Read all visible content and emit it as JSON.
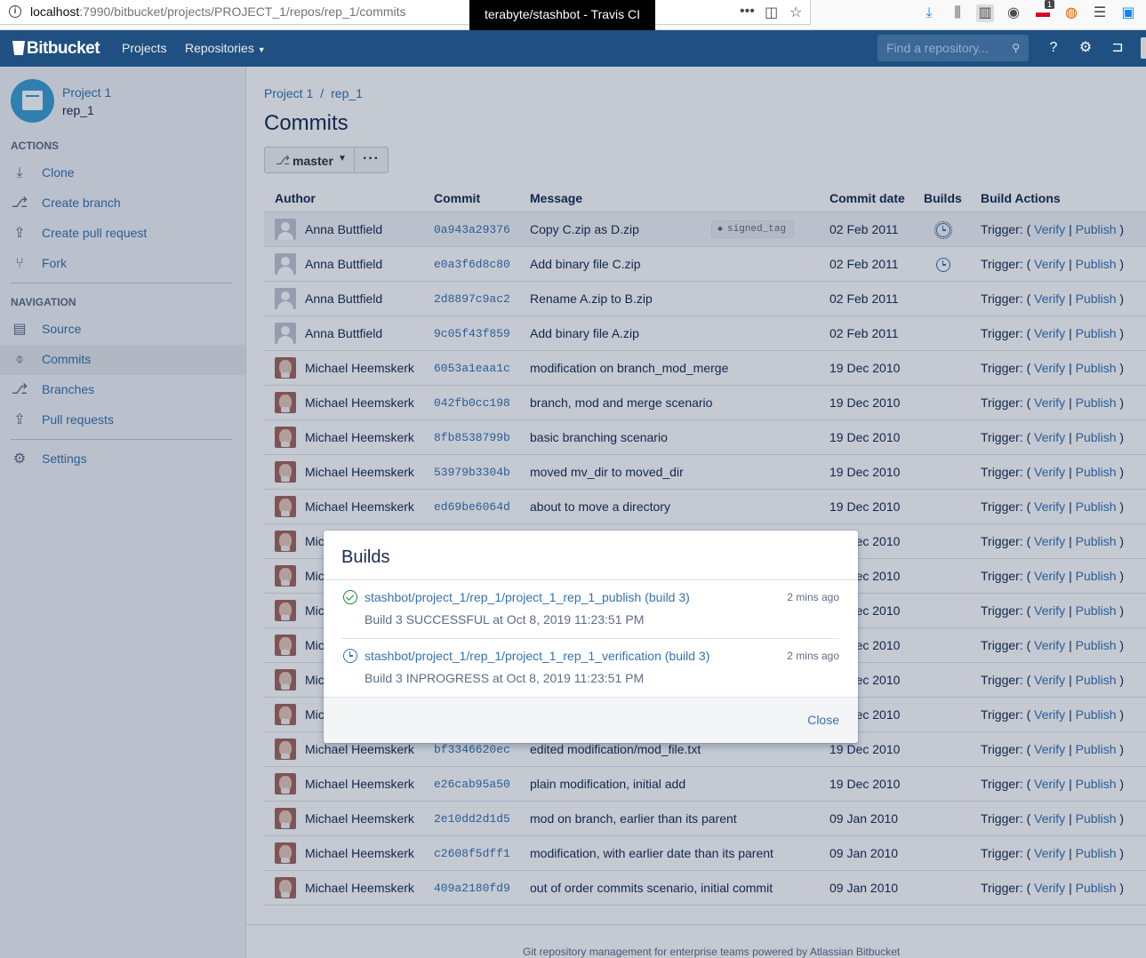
{
  "browser": {
    "url_host": "localhost",
    "url_path": ":7990/bitbucket/projects/PROJECT_1/repos/rep_1/commits",
    "tooltip": "terabyte/stashbot - Travis CI",
    "notification_badge": "1"
  },
  "header": {
    "logo": "Bitbucket",
    "nav_projects": "Projects",
    "nav_repositories": "Repositories",
    "search_placeholder": "Find a repository..."
  },
  "sidebar": {
    "project": "Project 1",
    "repo": "rep_1",
    "actions_title": "ACTIONS",
    "actions": [
      "Clone",
      "Create branch",
      "Create pull request",
      "Fork"
    ],
    "navigation_title": "NAVIGATION",
    "navigation": [
      "Source",
      "Commits",
      "Branches",
      "Pull requests"
    ],
    "settings": "Settings"
  },
  "breadcrumb": {
    "project": "Project 1",
    "separator": "/",
    "repo": "rep_1"
  },
  "page_title": "Commits",
  "branch": "master",
  "table": {
    "headers": [
      "Author",
      "Commit",
      "Message",
      "Commit date",
      "Builds",
      "Build Actions"
    ],
    "trigger_prefix": "Trigger: (",
    "verify": "Verify",
    "pipe": "|",
    "publish": "Publish",
    "trigger_suffix": ")",
    "rows": [
      {
        "author": "Anna Buttfield",
        "hash": "0a943a29376",
        "message": "Copy C.zip as D.zip",
        "tag": "signed_tag",
        "date": "02 Feb 2011",
        "build": true,
        "selected": true,
        "avatar": "gray"
      },
      {
        "author": "Anna Buttfield",
        "hash": "e0a3f6d8c80",
        "message": "Add binary file C.zip",
        "tag": "",
        "date": "02 Feb 2011",
        "build": true,
        "avatar": "gray"
      },
      {
        "author": "Anna Buttfield",
        "hash": "2d8897c9ac2",
        "message": "Rename A.zip to B.zip",
        "tag": "",
        "date": "02 Feb 2011",
        "build": false,
        "avatar": "gray"
      },
      {
        "author": "Anna Buttfield",
        "hash": "9c05f43f859",
        "message": "Add binary file A.zip",
        "tag": "",
        "date": "02 Feb 2011",
        "build": false,
        "avatar": "gray"
      },
      {
        "author": "Michael Heemskerk",
        "hash": "6053a1eaa1c",
        "message": "modification on branch_mod_merge",
        "tag": "",
        "date": "19 Dec 2010",
        "build": false,
        "avatar": "photo"
      },
      {
        "author": "Michael Heemskerk",
        "hash": "042fb0cc198",
        "message": "branch, mod and merge scenario",
        "tag": "",
        "date": "19 Dec 2010",
        "build": false,
        "avatar": "photo"
      },
      {
        "author": "Michael Heemskerk",
        "hash": "8fb8538799b",
        "message": "basic branching scenario",
        "tag": "",
        "date": "19 Dec 2010",
        "build": false,
        "avatar": "photo"
      },
      {
        "author": "Michael Heemskerk",
        "hash": "53979b3304b",
        "message": "moved mv_dir to moved_dir",
        "tag": "",
        "date": "19 Dec 2010",
        "build": false,
        "avatar": "photo"
      },
      {
        "author": "Michael Heemskerk",
        "hash": "ed69be6064d",
        "message": "about to move a directory",
        "tag": "",
        "date": "19 Dec 2010",
        "build": false,
        "avatar": "photo"
      },
      {
        "author": "Michael Heemskerk",
        "hash": "",
        "message": "",
        "tag": "",
        "date": "19 Dec 2010",
        "build": false,
        "avatar": "photo"
      },
      {
        "author": "Michael Heemskerk",
        "hash": "",
        "message": "",
        "tag": "",
        "date": "19 Dec 2010",
        "build": false,
        "avatar": "photo"
      },
      {
        "author": "Michael Heemskerk",
        "hash": "",
        "message": "",
        "tag": "",
        "date": "19 Dec 2010",
        "build": false,
        "avatar": "photo"
      },
      {
        "author": "Michael Heemskerk",
        "hash": "",
        "message": "",
        "tag": "",
        "date": "19 Dec 2010",
        "build": false,
        "avatar": "photo"
      },
      {
        "author": "Michael Heemskerk",
        "hash": "",
        "message": "",
        "tag": "",
        "date": "19 Dec 2010",
        "build": false,
        "avatar": "photo"
      },
      {
        "author": "Michael Heemskerk",
        "hash": "",
        "message": "",
        "tag": "",
        "date": "19 Dec 2010",
        "build": false,
        "avatar": "photo"
      },
      {
        "author": "Michael Heemskerk",
        "hash": "bf3346620ec",
        "message": "edited modification/mod_file.txt",
        "tag": "",
        "date": "19 Dec 2010",
        "build": false,
        "avatar": "photo"
      },
      {
        "author": "Michael Heemskerk",
        "hash": "e26cab95a50",
        "message": "plain modification, initial add",
        "tag": "",
        "date": "19 Dec 2010",
        "build": false,
        "avatar": "photo"
      },
      {
        "author": "Michael Heemskerk",
        "hash": "2e10dd2d1d5",
        "message": "mod on branch, earlier than its parent",
        "tag": "",
        "date": "09 Jan 2010",
        "build": false,
        "avatar": "photo"
      },
      {
        "author": "Michael Heemskerk",
        "hash": "c2608f5dff1",
        "message": "modification, with earlier date than its parent",
        "tag": "",
        "date": "09 Jan 2010",
        "build": false,
        "avatar": "photo"
      },
      {
        "author": "Michael Heemskerk",
        "hash": "409a2180fd9",
        "message": "out of order commits scenario, initial commit",
        "tag": "",
        "date": "09 Jan 2010",
        "build": false,
        "avatar": "photo"
      }
    ]
  },
  "dialog": {
    "title": "Builds",
    "builds": [
      {
        "status": "successful",
        "name": "stashbot/project_1/rep_1/project_1_rep_1_publish (build 3)",
        "desc": "Build 3 SUCCESSFUL at Oct 8, 2019 11:23:51 PM",
        "time": "2 mins ago"
      },
      {
        "status": "inprogress",
        "name": "stashbot/project_1/rep_1/project_1_rep_1_verification (build 3)",
        "desc": "Build 3 INPROGRESS at Oct 8, 2019 11:23:51 PM",
        "time": "2 mins ago"
      }
    ],
    "close": "Close"
  },
  "footer": "Git repository management for enterprise teams powered by Atlassian Bitbucket",
  "colors": {
    "header": "#205081",
    "link": "#3572b0",
    "success": "#14892c"
  }
}
